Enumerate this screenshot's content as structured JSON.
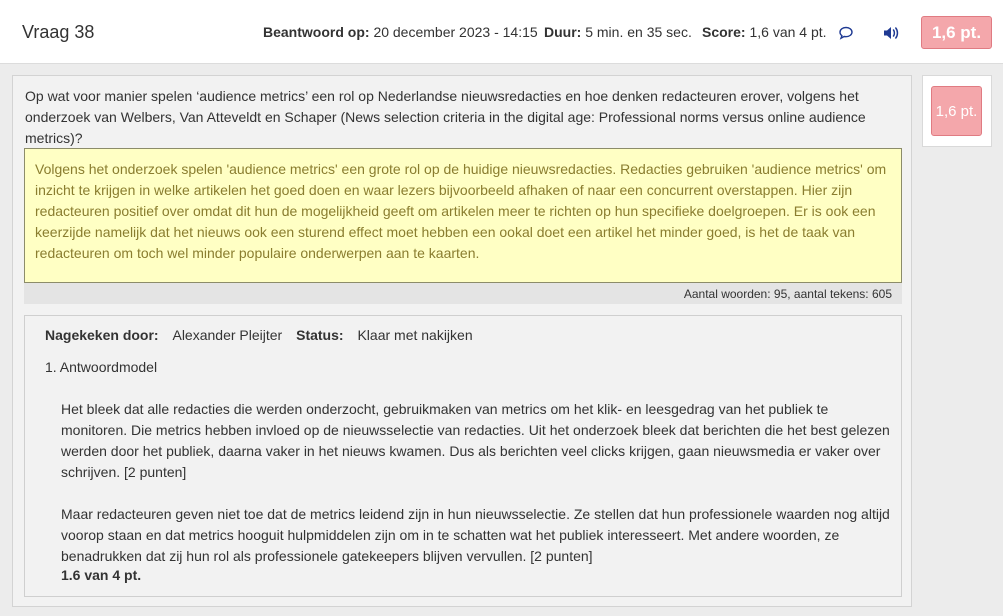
{
  "header": {
    "title": "Vraag 38",
    "answered_label": "Beantwoord op:",
    "answered_value": "20 december 2023 - 14:15",
    "duration_label": "Duur:",
    "duration_value": "5 min. en 35 sec.",
    "score_label": "Score:",
    "score_value": "1,6 van 4 pt.",
    "score_badge": "1,6 pt.",
    "comment_icon": "speech-bubble-icon",
    "audio_icon": "speaker-icon",
    "accent_color": "#1f3a93",
    "badge_color": "#f4a7ab"
  },
  "question": {
    "text": "Op wat voor manier spelen ‘audience metrics’ een rol op Nederlandse nieuwsredacties en hoe denken redacteuren erover, volgens het onderzoek van Welbers, Van Atteveldt en Schaper (News selection criteria in the digital age: Professional norms versus online audience metrics)?"
  },
  "answer": {
    "text": "Volgens het onderzoek spelen 'audience metrics' een grote rol op de huidige nieuwsredacties. Redacties gebruiken 'audience metrics' om inzicht te krijgen in welke artikelen het goed doen en waar lezers bijvoorbeeld afhaken of naar een concurrent overstappen. Hier zijn redacteuren positief over omdat dit hun de mogelijkheid geeft om artikelen meer te richten op hun specifieke doelgroepen. Er is ook een keerzijde namelijk dat het nieuws ook een sturend effect moet hebben een ookal doet een artikel het minder goed, is het de taak van redacteuren om toch wel minder populaire onderwerpen aan te kaarten.",
    "wordcount": "Aantal woorden: 95, aantal tekens: 605"
  },
  "review": {
    "reviewed_by_label": "Nagekeken door:",
    "reviewer_name": "Alexander Pleijter",
    "status_label": "Status:",
    "status_value": "Klaar met nakijken",
    "model_title": "1.  Antwoordmodel",
    "paragraph1": "Het bleek dat alle redacties die werden onderzocht, gebruikmaken van metrics om het klik- en leesgedrag van het publiek te monitoren. Die metrics hebben invloed op de nieuwsselectie van redacties. Uit het onderzoek bleek dat berichten die het best gelezen werden door het publiek, daarna vaker in het nieuws kwamen. Dus als berichten veel clicks krijgen, gaan nieuwsmedia er vaker over schrijven. [2 punten]",
    "paragraph2": "Maar redacteuren geven niet toe dat de metrics leidend zijn in hun nieuwsselectie. Ze stellen dat hun professionele waarden nog altijd voorop staan en dat metrics hooguit hulpmiddelen zijn om in te schatten wat het publiek interesseert. Met andere woorden, ze benadrukken dat zij hun rol als professionele gatekeepers blijven vervullen. [2 punten]",
    "final_score": "1.6 van 4 pt."
  },
  "side": {
    "score_badge": "1,6 pt."
  }
}
